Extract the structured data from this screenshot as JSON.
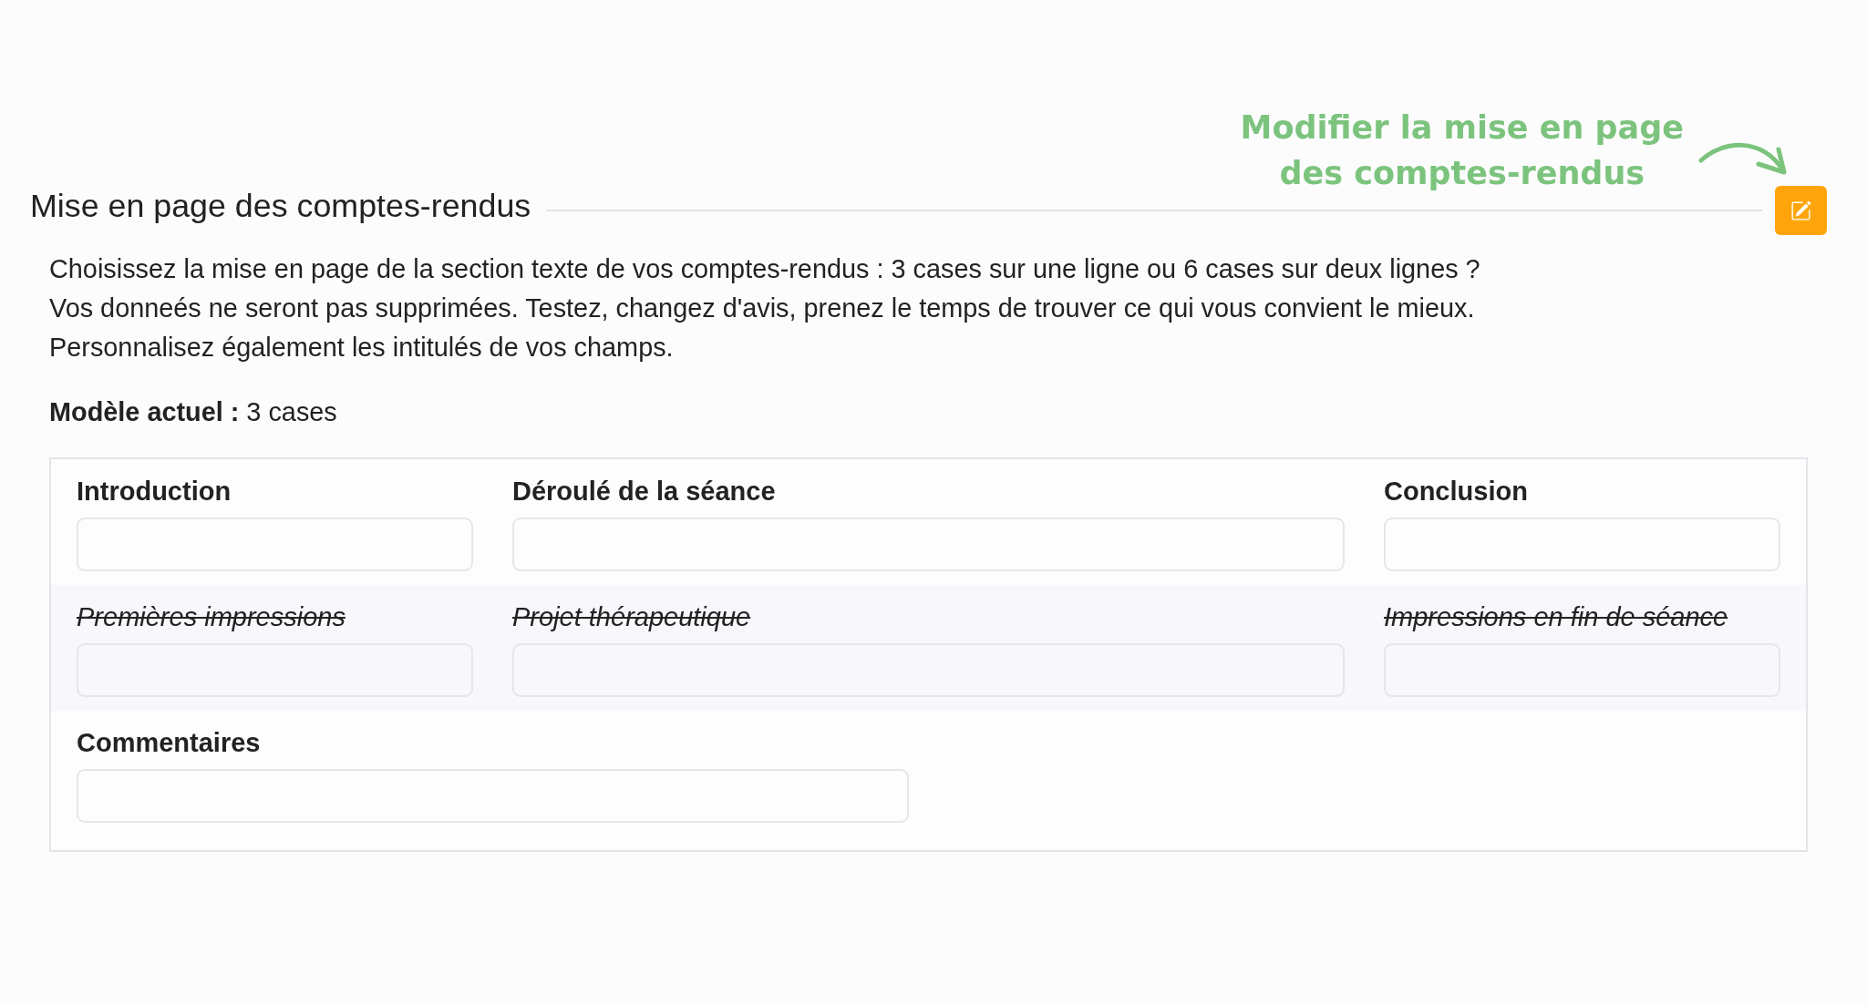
{
  "annotation": {
    "text_lines": [
      "Modifier la mise en page",
      "des comptes-rendus"
    ]
  },
  "section": {
    "title": "Mise en page des comptes-rendus"
  },
  "description_lines": [
    "Choisissez la mise en page de la section texte de vos comptes-rendus : 3 cases sur une ligne ou 6 cases sur deux lignes ?",
    "Vos donneés ne seront pas supprimées. Testez, changez d'avis, prenez le temps de trouver ce qui vous convient le mieux.",
    "Personnalisez également les intitulés de vos champs."
  ],
  "current_model": {
    "label": "Modèle actuel :",
    "value": "3 cases"
  },
  "form": {
    "rows": [
      {
        "fields": [
          {
            "label": "Introduction",
            "disabled": false
          },
          {
            "label": "Déroulé de la séance",
            "disabled": false
          },
          {
            "label": "Conclusion",
            "disabled": false
          }
        ]
      },
      {
        "fields": [
          {
            "label": "Premières impressions",
            "disabled": true
          },
          {
            "label": "Projet thérapeutique",
            "disabled": true
          },
          {
            "label": "Impressions en fin de séance",
            "disabled": true
          }
        ]
      },
      {
        "fields": [
          {
            "label": "Commentaires",
            "disabled": false
          }
        ]
      }
    ]
  }
}
